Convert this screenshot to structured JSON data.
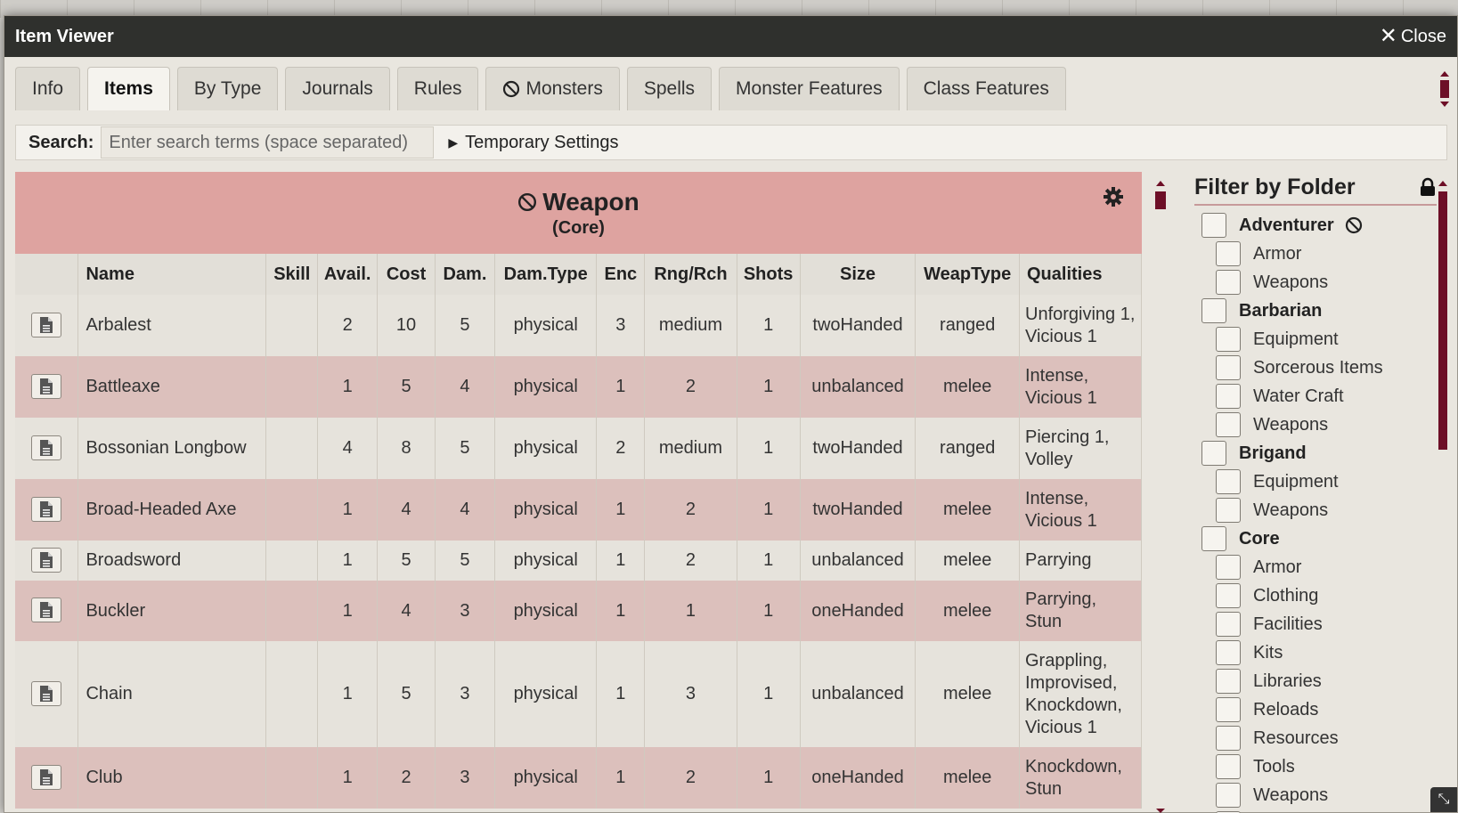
{
  "window": {
    "title": "Item Viewer",
    "close_label": "Close"
  },
  "tabs": [
    {
      "label": "Info",
      "active": false
    },
    {
      "label": "Items",
      "active": true
    },
    {
      "label": "By Type",
      "active": false
    },
    {
      "label": "Journals",
      "active": false
    },
    {
      "label": "Rules",
      "active": false
    },
    {
      "label": "Monsters",
      "active": false,
      "icon": "ban-icon"
    },
    {
      "label": "Spells",
      "active": false
    },
    {
      "label": "Monster Features",
      "active": false
    },
    {
      "label": "Class Features",
      "active": false
    }
  ],
  "search": {
    "label": "Search:",
    "placeholder": "Enter search terms (space separated)",
    "value": "",
    "temp_settings_label": "Temporary Settings"
  },
  "group": {
    "title": "Weapon",
    "subtitle": "(Core)",
    "icon": "ban-icon",
    "settings_icon": "gear-icon"
  },
  "columns": [
    "Name",
    "Skill",
    "Avail.",
    "Cost",
    "Dam.",
    "Dam.Type",
    "Enc",
    "Rng/Rch",
    "Shots",
    "Size",
    "WeapType",
    "Qualities"
  ],
  "rows": [
    {
      "name": "Arbalest",
      "skill": "",
      "avail": "2",
      "cost": "10",
      "dam": "5",
      "dam_type": "physical",
      "enc": "3",
      "rng": "medium",
      "shots": "1",
      "size": "twoHanded",
      "weap_type": "ranged",
      "qualities": "Unforgiving 1, Vicious 1"
    },
    {
      "name": "Battleaxe",
      "skill": "",
      "avail": "1",
      "cost": "5",
      "dam": "4",
      "dam_type": "physical",
      "enc": "1",
      "rng": "2",
      "shots": "1",
      "size": "unbalanced",
      "weap_type": "melee",
      "qualities": "Intense, Vicious 1"
    },
    {
      "name": "Bossonian Longbow",
      "skill": "",
      "avail": "4",
      "cost": "8",
      "dam": "5",
      "dam_type": "physical",
      "enc": "2",
      "rng": "medium",
      "shots": "1",
      "size": "twoHanded",
      "weap_type": "ranged",
      "qualities": "Piercing 1, Volley"
    },
    {
      "name": "Broad-Headed Axe",
      "skill": "",
      "avail": "1",
      "cost": "4",
      "dam": "4",
      "dam_type": "physical",
      "enc": "1",
      "rng": "2",
      "shots": "1",
      "size": "twoHanded",
      "weap_type": "melee",
      "qualities": "Intense, Vicious 1"
    },
    {
      "name": "Broadsword",
      "skill": "",
      "avail": "1",
      "cost": "5",
      "dam": "5",
      "dam_type": "physical",
      "enc": "1",
      "rng": "2",
      "shots": "1",
      "size": "unbalanced",
      "weap_type": "melee",
      "qualities": "Parrying"
    },
    {
      "name": "Buckler",
      "skill": "",
      "avail": "1",
      "cost": "4",
      "dam": "3",
      "dam_type": "physical",
      "enc": "1",
      "rng": "1",
      "shots": "1",
      "size": "oneHanded",
      "weap_type": "melee",
      "qualities": "Parrying, Stun"
    },
    {
      "name": "Chain",
      "skill": "",
      "avail": "1",
      "cost": "5",
      "dam": "3",
      "dam_type": "physical",
      "enc": "1",
      "rng": "3",
      "shots": "1",
      "size": "unbalanced",
      "weap_type": "melee",
      "qualities": "Grappling, Improvised, Knockdown, Vicious 1"
    },
    {
      "name": "Club",
      "skill": "",
      "avail": "1",
      "cost": "2",
      "dam": "3",
      "dam_type": "physical",
      "enc": "1",
      "rng": "2",
      "shots": "1",
      "size": "oneHanded",
      "weap_type": "melee",
      "qualities": "Knockdown, Stun"
    }
  ],
  "filter": {
    "title": "Filter by Folder",
    "lock_icon": "lock-icon",
    "folders": [
      {
        "label": "Adventurer",
        "icon": "ban-icon",
        "children": [
          "Armor",
          "Weapons"
        ]
      },
      {
        "label": "Barbarian",
        "children": [
          "Equipment",
          "Sorcerous Items",
          "Water Craft",
          "Weapons"
        ]
      },
      {
        "label": "Brigand",
        "children": [
          "Equipment",
          "Weapons"
        ]
      },
      {
        "label": "Core",
        "children": [
          "Armor",
          "Clothing",
          "Facilities",
          "Kits",
          "Libraries",
          "Reloads",
          "Resources",
          "Tools",
          "Weapons"
        ]
      }
    ]
  },
  "colors": {
    "titlebar": "#2f302d",
    "group_header": "#dea3a0",
    "row_even": "#dcc0bc",
    "accent": "#6d0f27"
  }
}
